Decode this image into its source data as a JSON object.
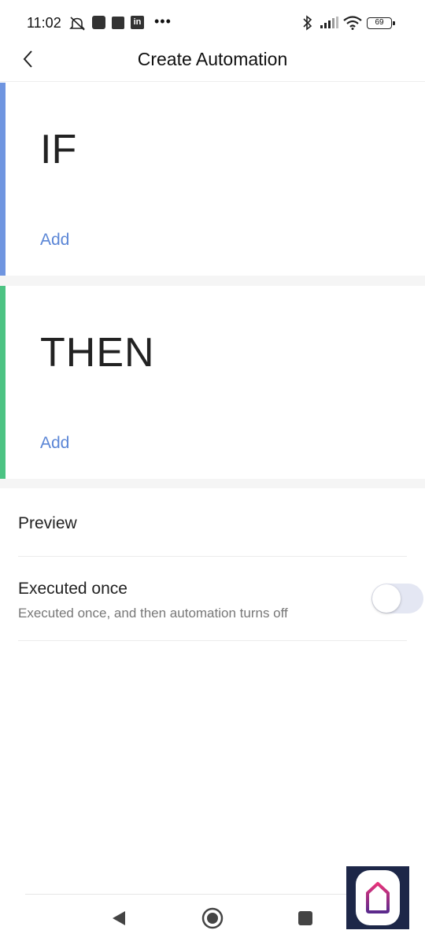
{
  "status_bar": {
    "time": "11:02",
    "battery": "69",
    "icons": [
      "mute-icon",
      "notification-icon",
      "app-icon",
      "linkedin-icon",
      "more-icon",
      "bluetooth-icon",
      "signal-icon",
      "wifi-icon",
      "battery-icon"
    ]
  },
  "header": {
    "title": "Create Automation",
    "back_icon": "chevron-left-icon"
  },
  "if_block": {
    "title": "IF",
    "add_label": "Add",
    "accent_color": "#6f95e0"
  },
  "then_block": {
    "title": "THEN",
    "add_label": "Add",
    "accent_color": "#4cc383"
  },
  "settings": {
    "preview_label": "Preview",
    "executed_once": {
      "title": "Executed once",
      "description": "Executed once, and then automation turns off",
      "enabled": false
    }
  },
  "nav": {
    "icons": [
      "nav-back-icon",
      "nav-home-icon",
      "nav-recents-icon"
    ]
  },
  "colors": {
    "link": "#5b86d6",
    "toggle_track_off": "#e4e7f3"
  }
}
